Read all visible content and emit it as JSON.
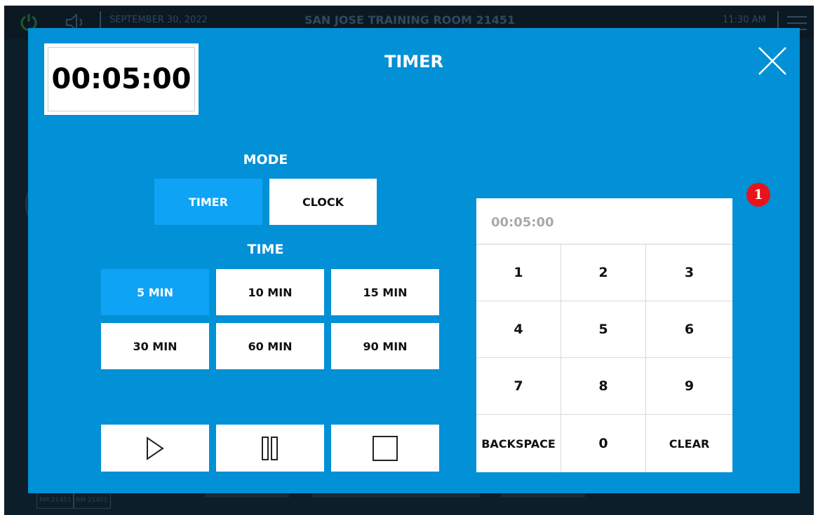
{
  "topbar": {
    "date": "SEPTEMBER 30, 2022",
    "room": "SAN JOSE TRAINING ROOM 21451",
    "time": "11:30 AM"
  },
  "background": {
    "tab_labels": [
      "RM 21451",
      "RM 21401"
    ]
  },
  "modal": {
    "title": "TIMER",
    "display_time": "00:05:00",
    "mode": {
      "label": "MODE",
      "options": [
        "TIMER",
        "CLOCK"
      ],
      "selected": "TIMER"
    },
    "time": {
      "label": "TIME",
      "options": [
        "5 MIN",
        "10 MIN",
        "15 MIN",
        "30 MIN",
        "60 MIN",
        "90 MIN"
      ],
      "selected": "5 MIN"
    },
    "controls": [
      "play-icon",
      "pause-icon",
      "stop-icon"
    ],
    "keypad": {
      "entry_value": "00:05:00",
      "keys": [
        "1",
        "2",
        "3",
        "4",
        "5",
        "6",
        "7",
        "8",
        "9",
        "BACKSPACE",
        "0",
        "CLEAR"
      ]
    },
    "badge": "1"
  },
  "colors": {
    "modal_bg": "#0290d6",
    "active_button": "#0ea3f5",
    "badge": "#e8131b"
  }
}
